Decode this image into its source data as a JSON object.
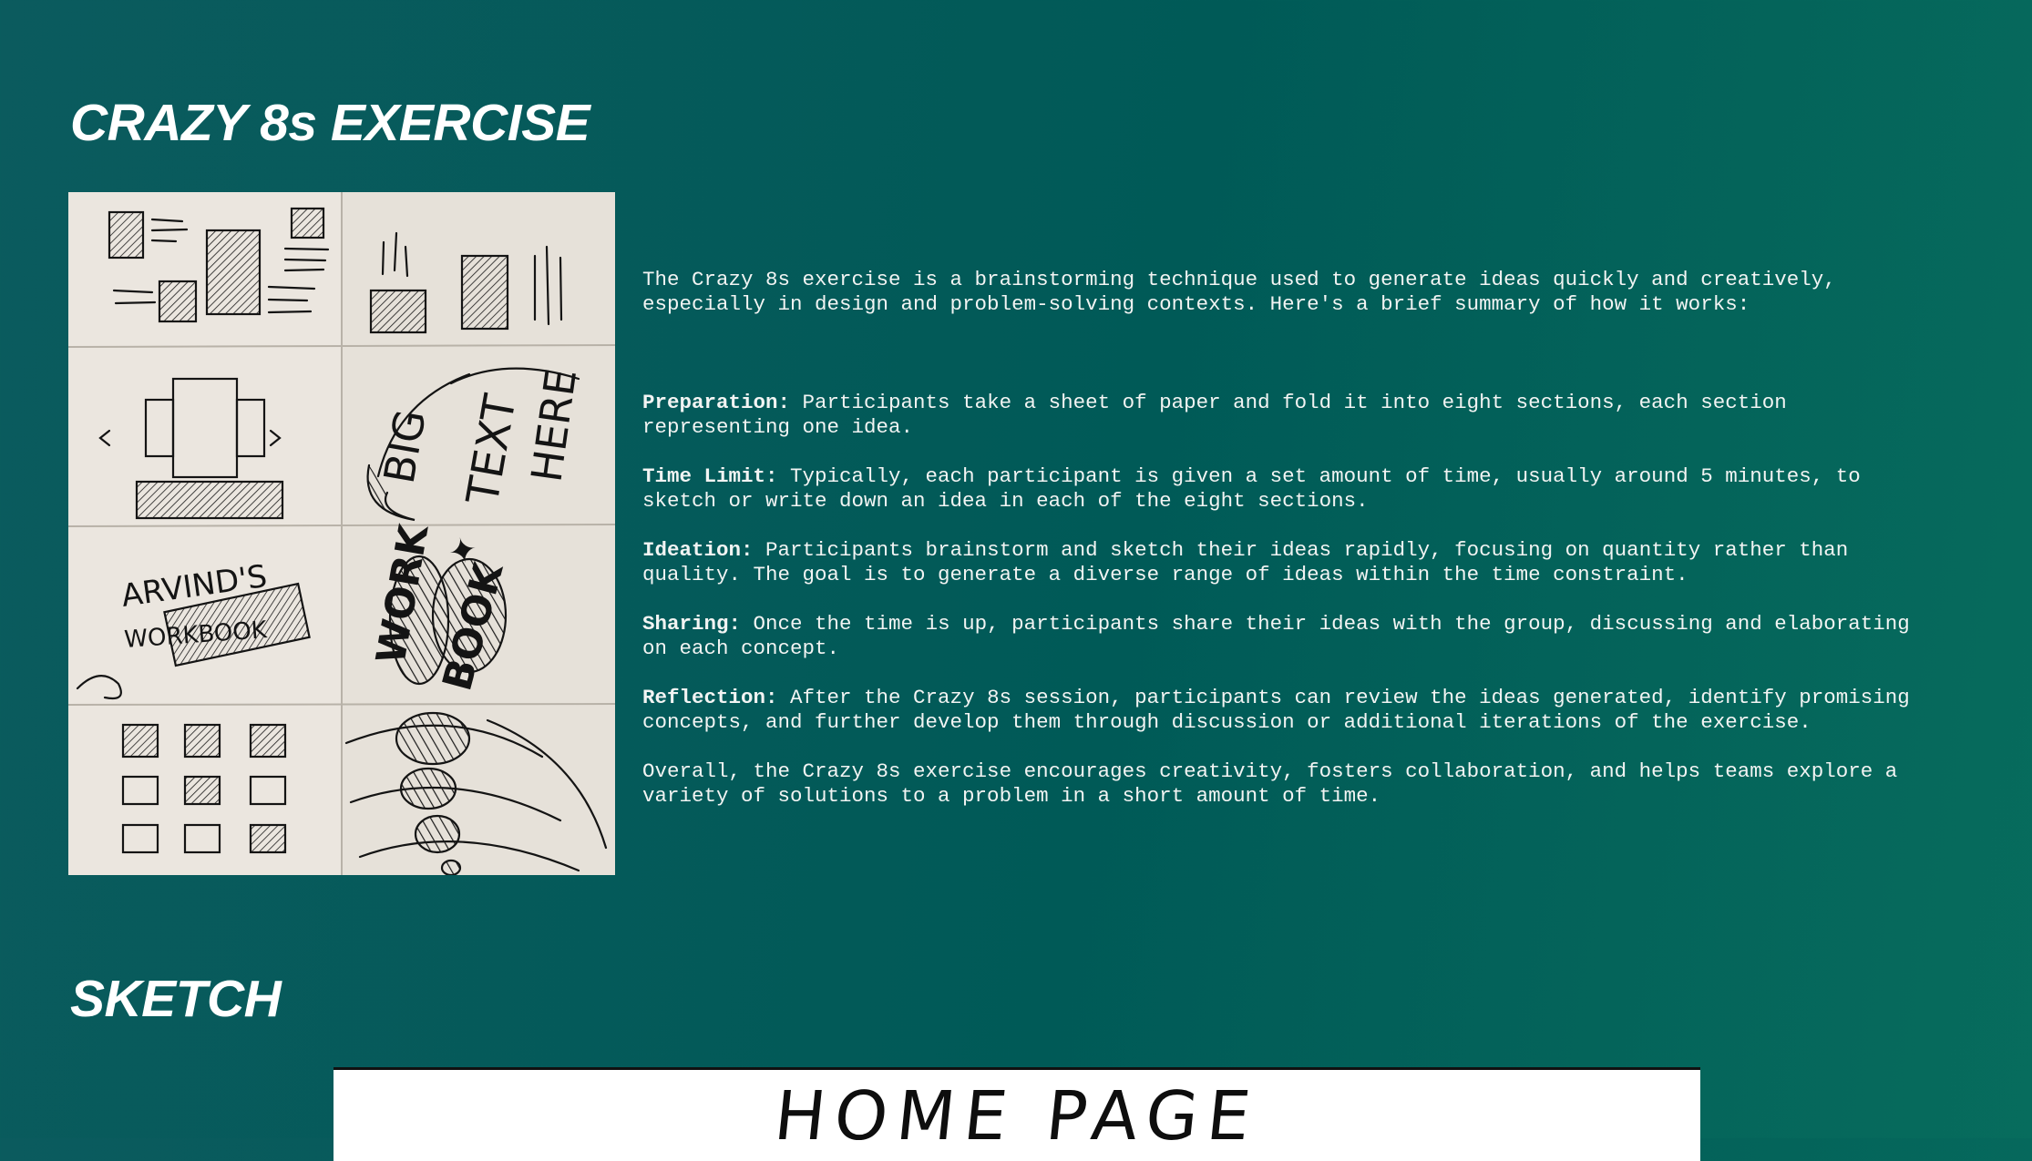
{
  "page": {
    "title": "CRAZY 8s EXERCISE",
    "sketch_section_title": "SKETCH"
  },
  "photo": {
    "handwriting": {
      "big": "BIG",
      "text": "TEXT",
      "here": "HERE",
      "arvinds": "ARVIND'S",
      "workbook": "WORKBOOK",
      "work": "WORK",
      "book": "BOOK"
    }
  },
  "description": {
    "intro": "The Crazy 8s exercise is a brainstorming technique used to generate ideas quickly and creatively, especially in design and problem-solving contexts. Here's a brief summary of how it works:",
    "steps": [
      {
        "term": "Preparation:",
        "text": " Participants take a sheet of paper and fold it into eight sections, each section representing one idea."
      },
      {
        "term": "Time Limit:",
        "text": " Typically, each participant is given a set amount of time, usually around 5 minutes, to sketch or write down an idea in each of the eight sections."
      },
      {
        "term": "Ideation:",
        "text": " Participants brainstorm and sketch their ideas rapidly, focusing on quantity rather than quality. The goal is to generate a diverse range of ideas within the time constraint."
      },
      {
        "term": "Sharing:",
        "text": " Once the time is up, participants share their ideas with the group, discussing and elaborating on each concept."
      },
      {
        "term": "Reflection:",
        "text": " After the Crazy 8s session, participants can review the ideas generated, identify promising concepts, and further develop them through discussion or additional iterations of the exercise."
      }
    ],
    "conclusion": "Overall, the Crazy 8s exercise encourages creativity, fosters collaboration, and helps teams explore a variety of solutions to a problem in a short amount of time."
  },
  "homepage_sketch": {
    "heading": "HOME PAGE"
  }
}
